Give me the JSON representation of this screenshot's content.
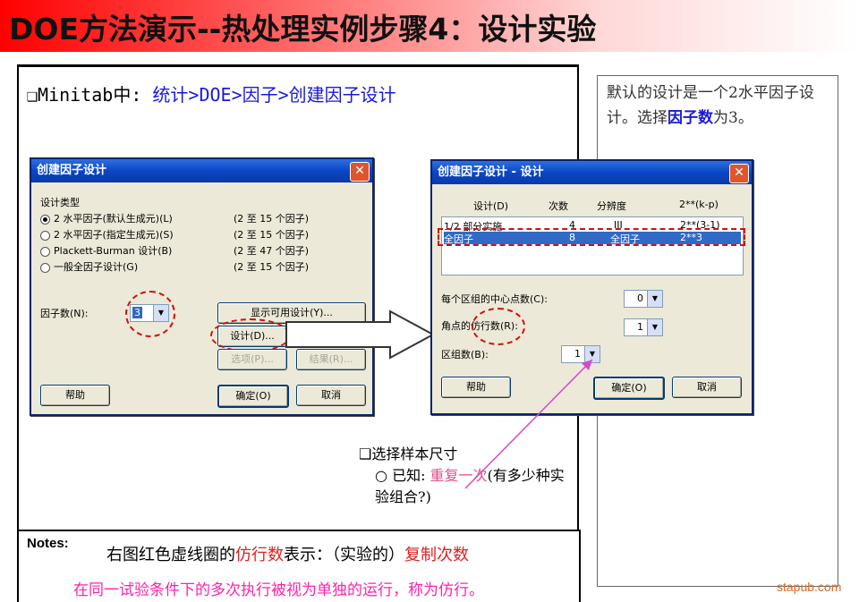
{
  "header": {
    "title": "DOE方法演示--热处理实例步骤4：设计实验"
  },
  "menu_path": {
    "prefix": "❑Minitab中: ",
    "path": "统计>DOE>因子>创建因子设计"
  },
  "right_panel": {
    "text_a": "默认的设计是一个2水平因子设计。选择",
    "highlight": "因子数",
    "text_b": "为3。"
  },
  "dialog1": {
    "title": "创建因子设计",
    "close": "✕",
    "group_label": "设计类型",
    "options": [
      {
        "label": "2 水平因子(默认生成元)(L)",
        "range": "(2 至 15 个因子)",
        "selected": true
      },
      {
        "label": "2 水平因子(指定生成元)(S)",
        "range": "(2 至 15 个因子)",
        "selected": false
      },
      {
        "label": "Plackett-Burman 设计(B)",
        "range": "(2 至 47 个因子)",
        "selected": false
      },
      {
        "label": "一般全因子设计(G)",
        "range": "(2 至 15 个因子)",
        "selected": false
      }
    ],
    "factor_label": "因子数(N):",
    "factor_value": "3",
    "show_button": "显示可用设计(Y)...",
    "design_button": "设计(D)...",
    "options_button": "选项(P)...",
    "results_button": "结果(R)...",
    "help_button": "帮助",
    "ok_button": "确定(O)",
    "cancel_button": "取消"
  },
  "dialog2": {
    "title": "创建因子设计 - 设计",
    "close": "✕",
    "columns": [
      "设计(D)",
      "次数",
      "分辨度",
      "2**(k-p)"
    ],
    "rows": [
      {
        "design": "1/2 部分实施",
        "runs": "4",
        "resolution": "III",
        "kp": "2**(3-1)",
        "selected": false
      },
      {
        "design": "全因子",
        "runs": "8",
        "resolution": "全因子",
        "kp": "2**3",
        "selected": true
      }
    ],
    "center_label": "每个区组的中心点数(C):",
    "center_value": "0",
    "replicates_label": "角点的仿行数(R):",
    "replicates_value": "1",
    "blocks_label": "区组数(B):",
    "blocks_value": "1",
    "help_button": "帮助",
    "ok_button": "确定(O)",
    "cancel_button": "取消"
  },
  "annotation": {
    "heading": "❑选择样本尺寸",
    "known": "已知: ",
    "emphasis": "重复一次",
    "rest": "(有多少种实验组合?)"
  },
  "notes": {
    "label": "Notes:",
    "line1_a": "右图红色虚线圈的",
    "line1_b": "仿行数",
    "line1_c": "表示：（实验的）",
    "line1_d": "复制次数",
    "line2": "在同一试验条件下的多次执行被视为单独的运行，称为仿行。"
  },
  "watermark": "stapub.com"
}
